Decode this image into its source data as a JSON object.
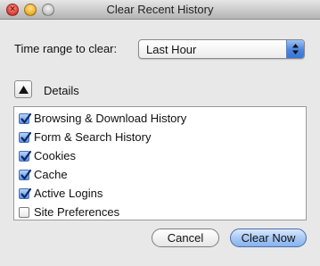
{
  "window": {
    "title": "Clear Recent History"
  },
  "time_range": {
    "label": "Time range to clear:",
    "selected": "Last Hour"
  },
  "details": {
    "label": "Details",
    "expanded": true
  },
  "items": [
    {
      "label": "Browsing & Download History",
      "checked": true
    },
    {
      "label": "Form & Search History",
      "checked": true
    },
    {
      "label": "Cookies",
      "checked": true
    },
    {
      "label": "Cache",
      "checked": true
    },
    {
      "label": "Active Logins",
      "checked": true
    },
    {
      "label": "Site Preferences",
      "checked": false
    }
  ],
  "buttons": {
    "cancel": "Cancel",
    "clear_now": "Clear Now"
  },
  "colors": {
    "accent": "#4b86e0",
    "checkbox_checked": "#5a92e6"
  },
  "icons": {
    "close": "close-icon",
    "minimize": "minimize-icon",
    "zoom": "zoom-icon",
    "stepper": "up-down-arrows-icon",
    "toggle": "triangle-up-icon",
    "check": "checkmark-icon"
  }
}
